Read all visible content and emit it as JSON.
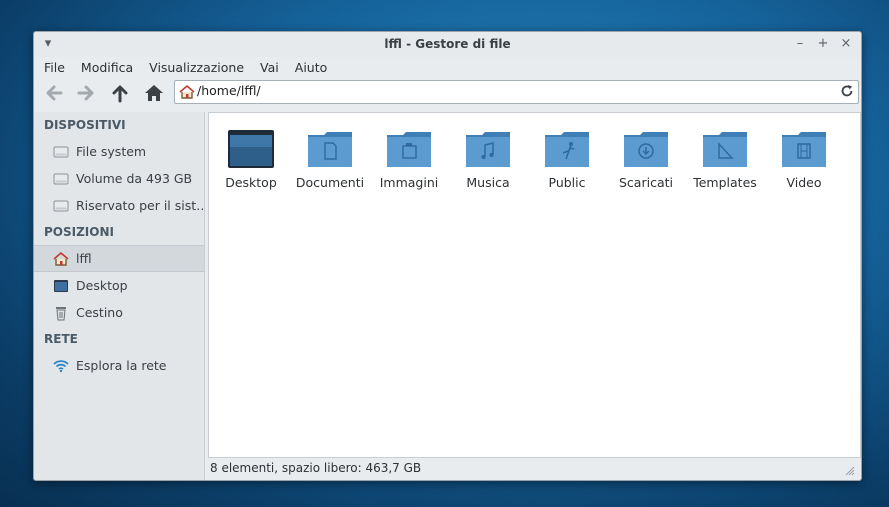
{
  "window": {
    "title": "lffl - Gestore di file",
    "controls": {
      "menu": "▾",
      "minimize": "–",
      "maximize": "+",
      "close": "×"
    }
  },
  "menu": [
    "File",
    "Modifica",
    "Visualizzazione",
    "Vai",
    "Aiuto"
  ],
  "toolbar": {
    "buttons": [
      "back-arrow-icon",
      "forward-arrow-icon",
      "up-arrow-icon",
      "home-icon"
    ],
    "address": "/home/lffl/"
  },
  "sidebar": {
    "devices": {
      "header": "DISPOSITIVI",
      "items": [
        "File system",
        "Volume da 493 GB",
        "Riservato per il sist…"
      ]
    },
    "places": {
      "header": "POSIZIONI",
      "items": [
        "lffl",
        "Desktop",
        "Cestino"
      ]
    },
    "network": {
      "header": "RETE",
      "items": [
        "Esplora la rete"
      ]
    }
  },
  "files": [
    {
      "name": "Desktop",
      "icon": "desktop-folder-icon"
    },
    {
      "name": "Documenti",
      "icon": "document-folder-icon"
    },
    {
      "name": "Immagini",
      "icon": "pictures-folder-icon"
    },
    {
      "name": "Musica",
      "icon": "music-folder-icon"
    },
    {
      "name": "Public",
      "icon": "public-folder-icon"
    },
    {
      "name": "Scaricati",
      "icon": "downloads-folder-icon"
    },
    {
      "name": "Templates",
      "icon": "templates-folder-icon"
    },
    {
      "name": "Video",
      "icon": "video-folder-icon"
    }
  ],
  "status": "8 elementi, spazio libero: 463,7 GB",
  "colors": {
    "folder": "#5b9bd0",
    "folder_dark": "#3f7fb5",
    "accent": "#2a87c4"
  }
}
